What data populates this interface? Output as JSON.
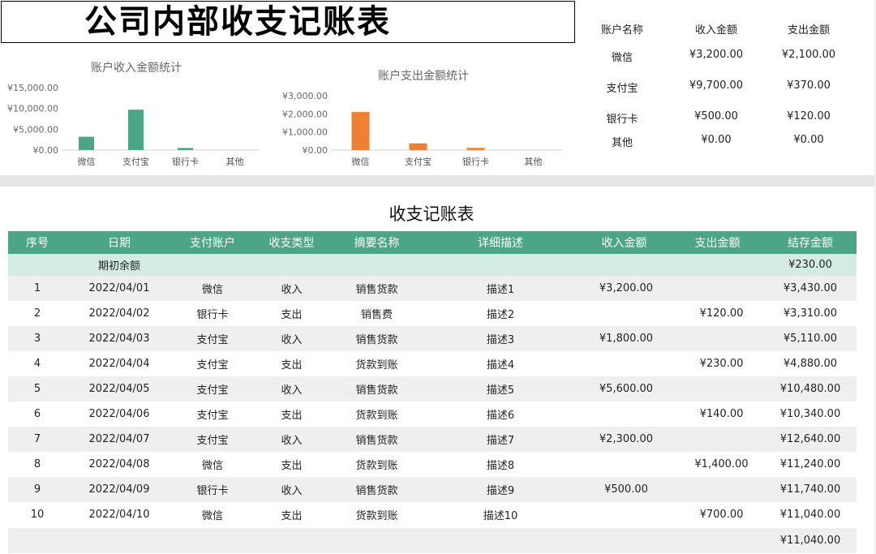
{
  "page_title": "公司内部收支记账表",
  "summary": {
    "headers": [
      "账户名称",
      "收入金额",
      "支出金额"
    ],
    "rows": [
      [
        "微信",
        "¥3,200.00",
        "¥2,100.00"
      ],
      [
        "支付宝",
        "¥9,700.00",
        "¥370.00"
      ],
      [
        "银行卡",
        "¥500.00",
        "¥120.00"
      ],
      [
        "其他",
        "¥0.00",
        "¥0.00"
      ]
    ]
  },
  "colors": {
    "income_bar": "#4ca585",
    "expense_bar": "#ee7f33",
    "header_bg": "#4ca585",
    "initial_row_bg": "#d2ebe3",
    "stripe_bg": "#efefef"
  },
  "chart_data": [
    {
      "type": "bar",
      "title": "账户收入金额统计",
      "categories": [
        "微信",
        "支付宝",
        "银行卡",
        "其他"
      ],
      "values": [
        3200,
        9700,
        500,
        0
      ],
      "ylim": [
        0,
        15000
      ],
      "yticks": [
        0,
        5000,
        10000,
        15000
      ],
      "ytick_labels": [
        "¥0.00",
        "¥5,000.00",
        "¥10,000.00",
        "¥15,000.00"
      ],
      "xlabel": "",
      "ylabel": "",
      "grid": false,
      "color": "#4ca585"
    },
    {
      "type": "bar",
      "title": "账户支出金额统计",
      "categories": [
        "微信",
        "支付宝",
        "银行卡",
        "其他"
      ],
      "values": [
        2100,
        370,
        120,
        0
      ],
      "ylim": [
        0,
        3000
      ],
      "yticks": [
        0,
        1000,
        2000,
        3000
      ],
      "ytick_labels": [
        "¥0.00",
        "¥1,000.00",
        "¥2,000.00",
        "¥3,000.00"
      ],
      "xlabel": "",
      "ylabel": "",
      "grid": false,
      "color": "#ee7f33"
    }
  ],
  "ledger": {
    "title": "收支记账表",
    "headers": [
      "序号",
      "日期",
      "支付账户",
      "收支类型",
      "摘要名称",
      "详细描述",
      "收入金额",
      "支出金额",
      "结存金额"
    ],
    "initial_label": "期初余额",
    "initial_balance": "¥230.00",
    "rows": [
      [
        "1",
        "2022/04/01",
        "微信",
        "收入",
        "销售货款",
        "描述1",
        "¥3,200.00",
        "",
        "¥3,430.00"
      ],
      [
        "2",
        "2022/04/02",
        "银行卡",
        "支出",
        "销售费",
        "描述2",
        "",
        "¥120.00",
        "¥3,310.00"
      ],
      [
        "3",
        "2022/04/03",
        "支付宝",
        "收入",
        "销售货款",
        "描述3",
        "¥1,800.00",
        "",
        "¥5,110.00"
      ],
      [
        "4",
        "2022/04/04",
        "支付宝",
        "支出",
        "货款到账",
        "描述4",
        "",
        "¥230.00",
        "¥4,880.00"
      ],
      [
        "5",
        "2022/04/05",
        "支付宝",
        "收入",
        "销售货款",
        "描述5",
        "¥5,600.00",
        "",
        "¥10,480.00"
      ],
      [
        "6",
        "2022/04/06",
        "支付宝",
        "支出",
        "货款到账",
        "描述6",
        "",
        "¥140.00",
        "¥10,340.00"
      ],
      [
        "7",
        "2022/04/07",
        "支付宝",
        "收入",
        "销售货款",
        "描述7",
        "¥2,300.00",
        "",
        "¥12,640.00"
      ],
      [
        "8",
        "2022/04/08",
        "微信",
        "支出",
        "货款到账",
        "描述8",
        "",
        "¥1,400.00",
        "¥11,240.00"
      ],
      [
        "9",
        "2022/04/09",
        "银行卡",
        "收入",
        "销售货款",
        "描述9",
        "¥500.00",
        "",
        "¥11,740.00"
      ],
      [
        "10",
        "2022/04/10",
        "微信",
        "支出",
        "货款到账",
        "描述10",
        "",
        "¥700.00",
        "¥11,040.00"
      ]
    ],
    "final_balance": "¥11,040.00"
  }
}
